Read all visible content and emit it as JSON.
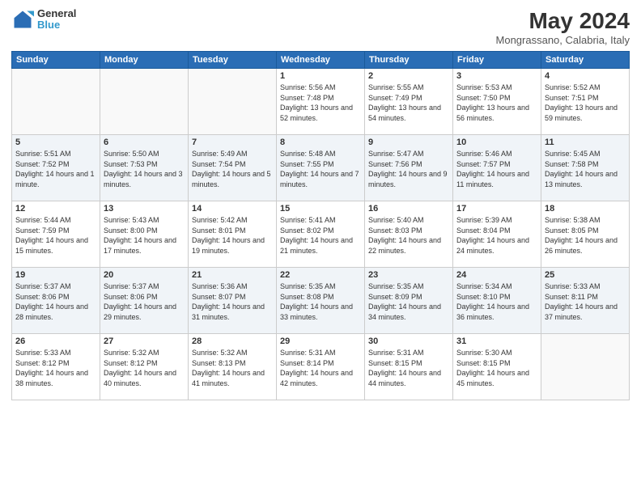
{
  "logo": {
    "line1": "General",
    "line2": "Blue"
  },
  "title": "May 2024",
  "location": "Mongrassano, Calabria, Italy",
  "days_of_week": [
    "Sunday",
    "Monday",
    "Tuesday",
    "Wednesday",
    "Thursday",
    "Friday",
    "Saturday"
  ],
  "weeks": [
    [
      {
        "num": "",
        "empty": true
      },
      {
        "num": "",
        "empty": true
      },
      {
        "num": "",
        "empty": true
      },
      {
        "num": "1",
        "sunrise": "5:56 AM",
        "sunset": "7:48 PM",
        "daylight": "13 hours and 52 minutes."
      },
      {
        "num": "2",
        "sunrise": "5:55 AM",
        "sunset": "7:49 PM",
        "daylight": "13 hours and 54 minutes."
      },
      {
        "num": "3",
        "sunrise": "5:53 AM",
        "sunset": "7:50 PM",
        "daylight": "13 hours and 56 minutes."
      },
      {
        "num": "4",
        "sunrise": "5:52 AM",
        "sunset": "7:51 PM",
        "daylight": "13 hours and 59 minutes."
      }
    ],
    [
      {
        "num": "5",
        "sunrise": "5:51 AM",
        "sunset": "7:52 PM",
        "daylight": "14 hours and 1 minute."
      },
      {
        "num": "6",
        "sunrise": "5:50 AM",
        "sunset": "7:53 PM",
        "daylight": "14 hours and 3 minutes."
      },
      {
        "num": "7",
        "sunrise": "5:49 AM",
        "sunset": "7:54 PM",
        "daylight": "14 hours and 5 minutes."
      },
      {
        "num": "8",
        "sunrise": "5:48 AM",
        "sunset": "7:55 PM",
        "daylight": "14 hours and 7 minutes."
      },
      {
        "num": "9",
        "sunrise": "5:47 AM",
        "sunset": "7:56 PM",
        "daylight": "14 hours and 9 minutes."
      },
      {
        "num": "10",
        "sunrise": "5:46 AM",
        "sunset": "7:57 PM",
        "daylight": "14 hours and 11 minutes."
      },
      {
        "num": "11",
        "sunrise": "5:45 AM",
        "sunset": "7:58 PM",
        "daylight": "14 hours and 13 minutes."
      }
    ],
    [
      {
        "num": "12",
        "sunrise": "5:44 AM",
        "sunset": "7:59 PM",
        "daylight": "14 hours and 15 minutes."
      },
      {
        "num": "13",
        "sunrise": "5:43 AM",
        "sunset": "8:00 PM",
        "daylight": "14 hours and 17 minutes."
      },
      {
        "num": "14",
        "sunrise": "5:42 AM",
        "sunset": "8:01 PM",
        "daylight": "14 hours and 19 minutes."
      },
      {
        "num": "15",
        "sunrise": "5:41 AM",
        "sunset": "8:02 PM",
        "daylight": "14 hours and 21 minutes."
      },
      {
        "num": "16",
        "sunrise": "5:40 AM",
        "sunset": "8:03 PM",
        "daylight": "14 hours and 22 minutes."
      },
      {
        "num": "17",
        "sunrise": "5:39 AM",
        "sunset": "8:04 PM",
        "daylight": "14 hours and 24 minutes."
      },
      {
        "num": "18",
        "sunrise": "5:38 AM",
        "sunset": "8:05 PM",
        "daylight": "14 hours and 26 minutes."
      }
    ],
    [
      {
        "num": "19",
        "sunrise": "5:37 AM",
        "sunset": "8:06 PM",
        "daylight": "14 hours and 28 minutes."
      },
      {
        "num": "20",
        "sunrise": "5:37 AM",
        "sunset": "8:06 PM",
        "daylight": "14 hours and 29 minutes."
      },
      {
        "num": "21",
        "sunrise": "5:36 AM",
        "sunset": "8:07 PM",
        "daylight": "14 hours and 31 minutes."
      },
      {
        "num": "22",
        "sunrise": "5:35 AM",
        "sunset": "8:08 PM",
        "daylight": "14 hours and 33 minutes."
      },
      {
        "num": "23",
        "sunrise": "5:35 AM",
        "sunset": "8:09 PM",
        "daylight": "14 hours and 34 minutes."
      },
      {
        "num": "24",
        "sunrise": "5:34 AM",
        "sunset": "8:10 PM",
        "daylight": "14 hours and 36 minutes."
      },
      {
        "num": "25",
        "sunrise": "5:33 AM",
        "sunset": "8:11 PM",
        "daylight": "14 hours and 37 minutes."
      }
    ],
    [
      {
        "num": "26",
        "sunrise": "5:33 AM",
        "sunset": "8:12 PM",
        "daylight": "14 hours and 38 minutes."
      },
      {
        "num": "27",
        "sunrise": "5:32 AM",
        "sunset": "8:12 PM",
        "daylight": "14 hours and 40 minutes."
      },
      {
        "num": "28",
        "sunrise": "5:32 AM",
        "sunset": "8:13 PM",
        "daylight": "14 hours and 41 minutes."
      },
      {
        "num": "29",
        "sunrise": "5:31 AM",
        "sunset": "8:14 PM",
        "daylight": "14 hours and 42 minutes."
      },
      {
        "num": "30",
        "sunrise": "5:31 AM",
        "sunset": "8:15 PM",
        "daylight": "14 hours and 44 minutes."
      },
      {
        "num": "31",
        "sunrise": "5:30 AM",
        "sunset": "8:15 PM",
        "daylight": "14 hours and 45 minutes."
      },
      {
        "num": "",
        "empty": true
      }
    ]
  ]
}
